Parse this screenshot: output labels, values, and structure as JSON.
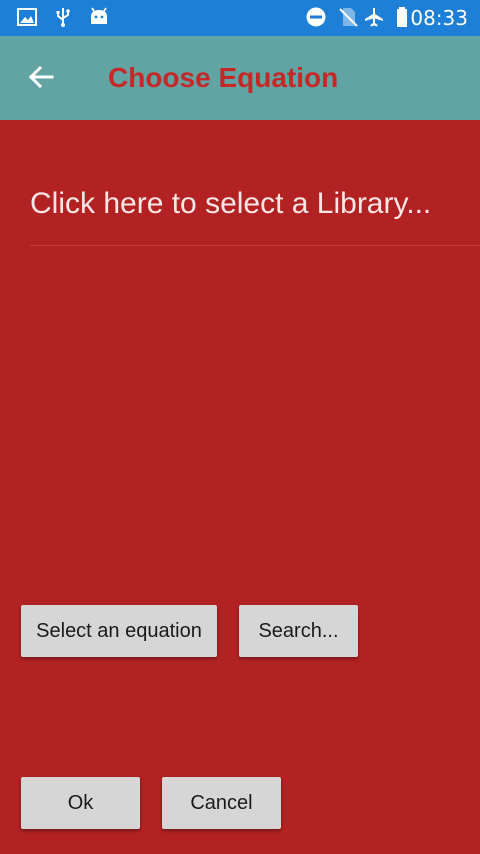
{
  "status_bar": {
    "time": "08:33",
    "icons": [
      "image-icon",
      "usb-icon",
      "android-icon",
      "do-not-disturb-icon",
      "no-sim-icon",
      "airplane-mode-icon",
      "battery-icon"
    ]
  },
  "app_bar": {
    "title": "Choose Equation",
    "back_icon": "arrow-left-icon"
  },
  "library_selector": {
    "label": "Click here to select a Library..."
  },
  "buttons": {
    "select_equation": "Select an equation",
    "search": "Search...",
    "ok": "Ok",
    "cancel": "Cancel"
  },
  "colors": {
    "status_bar": "#1e7fd6",
    "app_bar": "#62a3a3",
    "title": "#c62828",
    "background": "#b22222",
    "button": "#d6d6d6"
  }
}
